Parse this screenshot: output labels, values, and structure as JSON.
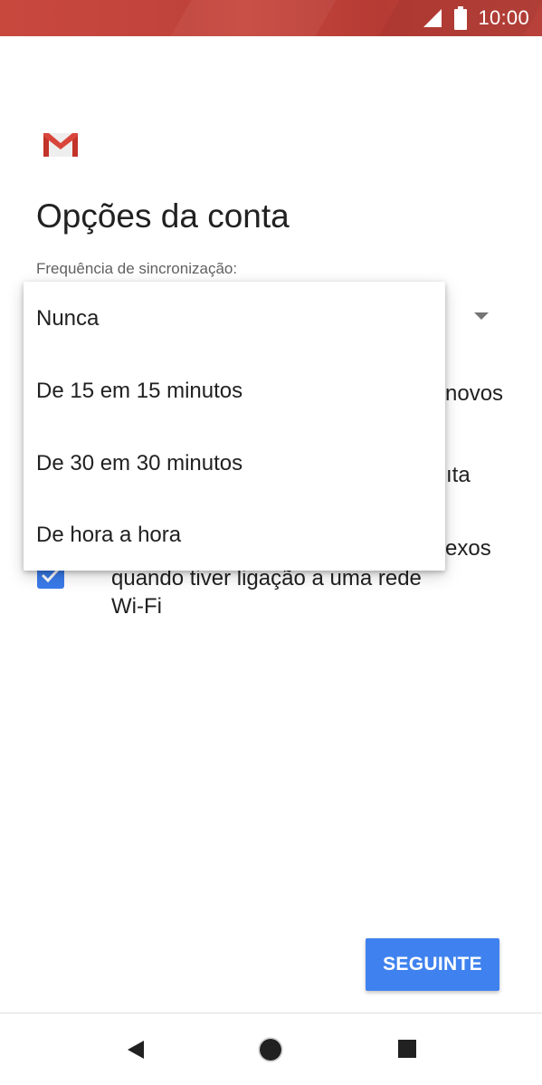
{
  "status_bar": {
    "time": "10:00",
    "icons": [
      "signal-icon",
      "battery-icon"
    ],
    "color": "#c0433b"
  },
  "header": {
    "logo_icon": "gmail-logo",
    "title": "Opções da conta"
  },
  "sync": {
    "label": "Frequência de sincronização:",
    "options": [
      "Nunca",
      "De 15 em 15 minutos",
      "De 30 em 30 minutos",
      "De hora a hora"
    ]
  },
  "background_options": {
    "notify_fragment": "novos",
    "sync_fragment": "ıta",
    "attach_fragment": "exos",
    "attach_line2": "quando tiver ligação a uma rede",
    "attach_line3": "Wi-Fi"
  },
  "footer": {
    "next_label": "SEGUINTE",
    "accent": "#3f82ef"
  },
  "nav": {
    "icons": [
      "back-icon",
      "home-icon",
      "recent-apps-icon"
    ]
  }
}
